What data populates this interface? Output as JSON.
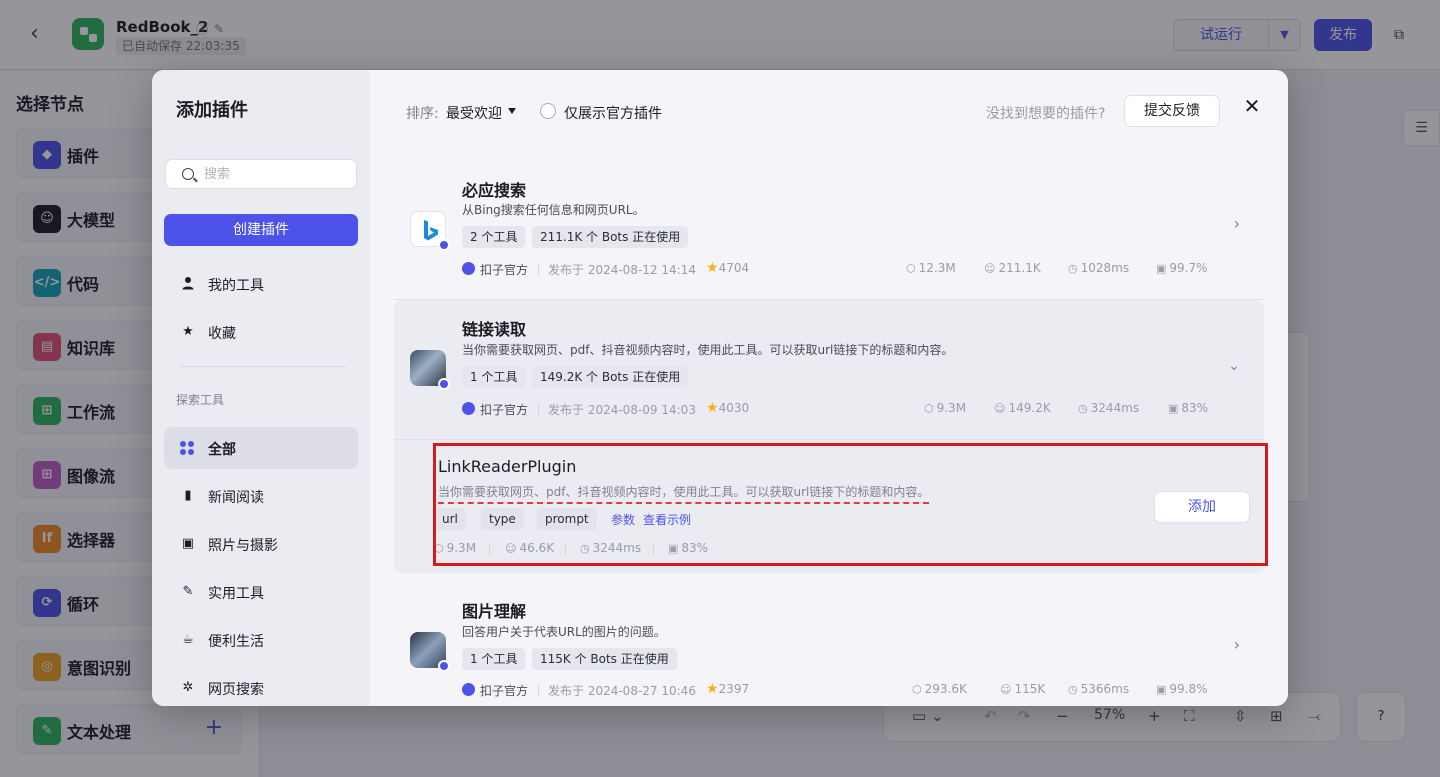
{
  "topbar": {
    "title": "RedBook_2",
    "saved": "已自动保存 22:03:35",
    "trial_run": "试运行",
    "publish": "发布"
  },
  "node_panel": {
    "title": "选择节点",
    "items": [
      {
        "label": "插件",
        "icon": "plugin-icon",
        "color": "#4d53e8"
      },
      {
        "label": "大模型",
        "icon": "llm-icon",
        "color": "#1c1d23"
      },
      {
        "label": "代码",
        "icon": "code-icon",
        "color": "#14a3b8"
      },
      {
        "label": "知识库",
        "icon": "knowledge-icon",
        "color": "#e0527a"
      },
      {
        "label": "工作流",
        "icon": "workflow-icon",
        "color": "#2fb55e"
      },
      {
        "label": "图像流",
        "icon": "imageflow-icon",
        "color": "#c05ec6"
      },
      {
        "label": "选择器",
        "icon": "selector-icon",
        "color": "#f08a24"
      },
      {
        "label": "循环",
        "icon": "loop-icon",
        "color": "#4d53e8"
      },
      {
        "label": "意图识别",
        "icon": "intent-icon",
        "color": "#f0a224"
      },
      {
        "label": "文本处理",
        "icon": "text-icon",
        "color": "#2fb55e"
      }
    ]
  },
  "zoom": {
    "value": "57%"
  },
  "modal": {
    "title": "添加插件",
    "search_placeholder": "搜索",
    "create_button": "创建插件",
    "menu_top": [
      {
        "label": "我的工具",
        "icon": "user-icon"
      },
      {
        "label": "收藏",
        "icon": "star-icon"
      }
    ],
    "section_title": "探索工具",
    "menu_explore": [
      {
        "label": "全部",
        "icon": "grid-icon",
        "active": true
      },
      {
        "label": "新闻阅读",
        "icon": "book-icon"
      },
      {
        "label": "照片与摄影",
        "icon": "image-icon"
      },
      {
        "label": "实用工具",
        "icon": "wrench-icon"
      },
      {
        "label": "便利生活",
        "icon": "cup-icon"
      },
      {
        "label": "网页搜索",
        "icon": "web-search-icon"
      }
    ],
    "sort_label": "排序:",
    "sort_value": "最受欢迎",
    "official_only": "仅展示官方插件",
    "not_found": "没找到想要的插件?",
    "feedback": "提交反馈"
  },
  "plugins": [
    {
      "name": "必应搜索",
      "desc": "从Bing搜索任何信息和网页URL。",
      "tags": [
        "2 个工具",
        "211.1K 个 Bots 正在使用"
      ],
      "publisher": "扣子官方",
      "published": "发布于 2024-08-12 14:14",
      "stars": "4704",
      "stats": [
        "12.3M",
        "211.1K",
        "1028ms",
        "99.7%"
      ]
    },
    {
      "name": "链接读取",
      "desc": "当你需要获取网页、pdf、抖音视频内容时，使用此工具。可以获取url链接下的标题和内容。",
      "tags": [
        "1 个工具",
        "149.2K 个 Bots 正在使用"
      ],
      "publisher": "扣子官方",
      "published": "发布于 2024-08-09 14:03",
      "stars": "4030",
      "stats": [
        "9.3M",
        "149.2K",
        "3244ms",
        "83%"
      ],
      "tool": {
        "name": "LinkReaderPlugin",
        "desc": "当你需要获取网页、pdf、抖音视频内容时，使用此工具。可以获取url链接下的标题和内容。",
        "params": [
          "url",
          "type",
          "prompt"
        ],
        "params_link": "参数",
        "example_link": "查看示例",
        "stats": [
          "9.3M",
          "46.6K",
          "3244ms",
          "83%"
        ],
        "add": "添加"
      }
    },
    {
      "name": "图片理解",
      "desc": "回答用户关于代表URL的图片的问题。",
      "tags": [
        "1 个工具",
        "115K 个 Bots 正在使用"
      ],
      "publisher": "扣子官方",
      "published": "发布于 2024-08-27 10:46",
      "stars": "2397",
      "stats": [
        "293.6K",
        "115K",
        "5366ms",
        "99.8%"
      ]
    }
  ]
}
